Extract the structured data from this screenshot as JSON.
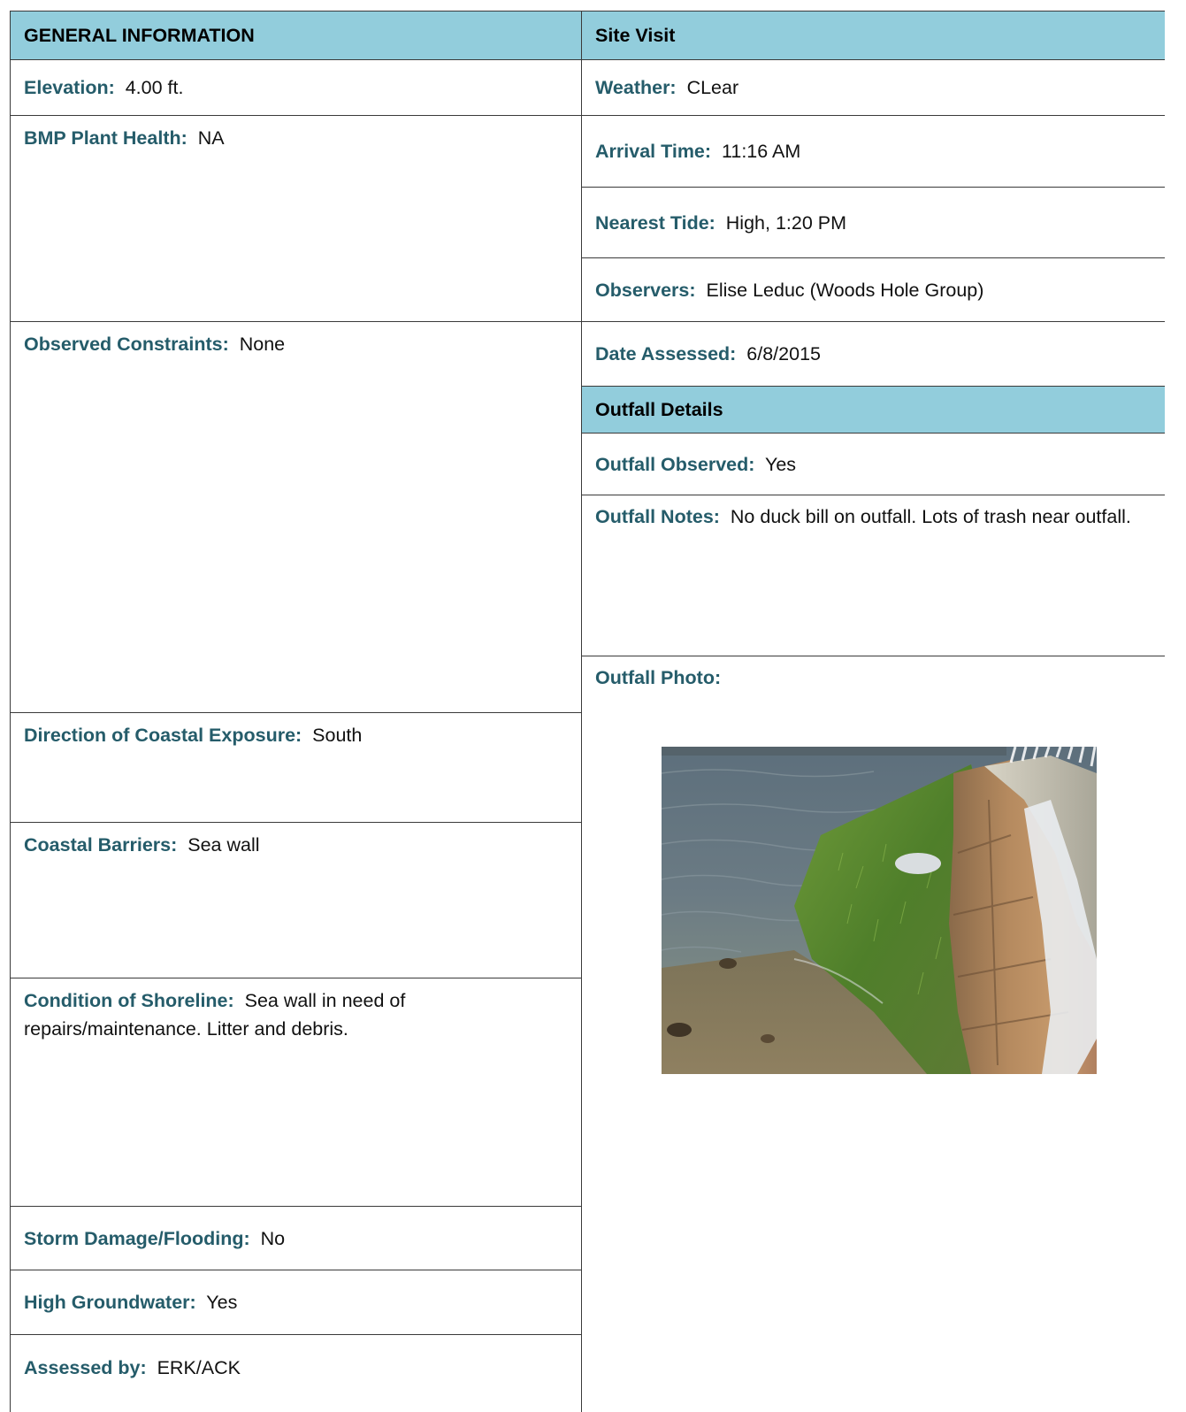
{
  "general": {
    "header": "GENERAL INFORMATION",
    "elevation": {
      "label": "Elevation:",
      "value": "4.00 ft."
    },
    "plant_health": {
      "label": "BMP Plant Health:",
      "value": "NA"
    },
    "constraints": {
      "label": "Observed Constraints:",
      "value": "None"
    },
    "exposure": {
      "label": "Direction of Coastal Exposure:",
      "value": "South"
    },
    "barriers": {
      "label": "Coastal Barriers:",
      "value": "Sea wall"
    },
    "shoreline": {
      "label": "Condition of Shoreline:",
      "value": "Sea wall in need of repairs/maintenance.  Litter and debris."
    },
    "storm": {
      "label": "Storm Damage/Flooding:",
      "value": "No"
    },
    "groundwater": {
      "label": "High Groundwater:",
      "value": "Yes"
    },
    "assessed_by": {
      "label": "Assessed by:",
      "value": "ERK/ACK"
    }
  },
  "site_visit": {
    "header": "Site Visit",
    "weather": {
      "label": "Weather:",
      "value": "CLear"
    },
    "arrival": {
      "label": "Arrival Time:",
      "value": "11:16 AM"
    },
    "tide": {
      "label": "Nearest Tide:",
      "value": "High, 1:20 PM"
    },
    "observers": {
      "label": "Observers:",
      "value": "Elise Leduc (Woods Hole Group)"
    },
    "date": {
      "label": "Date Assessed:",
      "value": "6/8/2015"
    }
  },
  "outfall": {
    "header": "Outfall Details",
    "observed": {
      "label": "Outfall Observed:",
      "value": "Yes"
    },
    "notes": {
      "label": "Outfall Notes:",
      "value": "No duck bill on outfall.  Lots of trash near outfall."
    },
    "photo": {
      "label": "Outfall Photo:"
    }
  }
}
